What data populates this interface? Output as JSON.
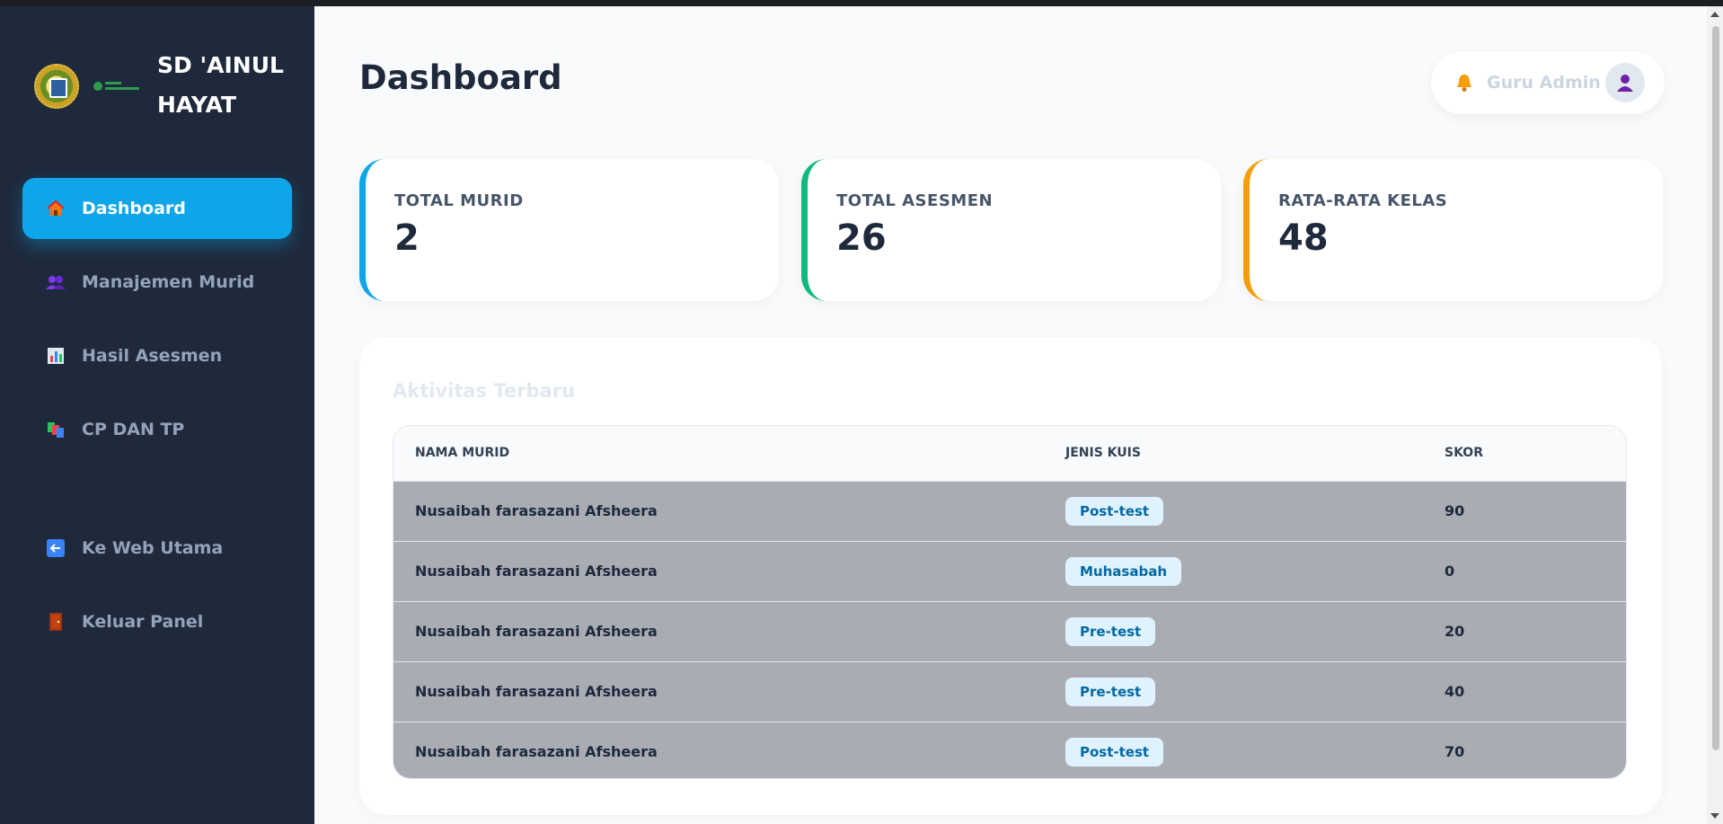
{
  "sidebar": {
    "brand_name": "SD 'AINUL HAYAT",
    "items": [
      {
        "label": "Dashboard",
        "icon": "house-icon",
        "active": true
      },
      {
        "label": "Manajemen Murid",
        "icon": "users-icon"
      },
      {
        "label": "Hasil Asesmen",
        "icon": "bar-chart-icon"
      },
      {
        "label": "CP DAN TP",
        "icon": "books-icon"
      },
      {
        "label": "Ke Web Utama",
        "icon": "back-arrow-icon"
      },
      {
        "label": "Keluar Panel",
        "icon": "door-icon"
      }
    ]
  },
  "header": {
    "title": "Dashboard",
    "user_name": "Guru Admin"
  },
  "stats": [
    {
      "label": "TOTAL MURID",
      "value": "2",
      "accent": "#0ea5e9"
    },
    {
      "label": "TOTAL ASESMEN",
      "value": "26",
      "accent": "#10b981"
    },
    {
      "label": "RATA-RATA KELAS",
      "value": "48",
      "accent": "#f59e0b"
    }
  ],
  "activity": {
    "title": "Aktivitas Terbaru",
    "columns": [
      "NAMA MURID",
      "JENIS KUIS",
      "SKOR"
    ],
    "rows": [
      {
        "name": "Nusaibah farasazani Afsheera",
        "quiz": "Post-test",
        "score": "90"
      },
      {
        "name": "Nusaibah farasazani Afsheera",
        "quiz": "Muhasabah",
        "score": "0"
      },
      {
        "name": "Nusaibah farasazani Afsheera",
        "quiz": "Pre-test",
        "score": "20"
      },
      {
        "name": "Nusaibah farasazani Afsheera",
        "quiz": "Pre-test",
        "score": "40"
      },
      {
        "name": "Nusaibah farasazani Afsheera",
        "quiz": "Post-test",
        "score": "70"
      }
    ]
  },
  "colors": {
    "sidebar_bg": "#1e293b",
    "active_nav": "#0ea5e9",
    "badge_text": "#0369a1"
  }
}
